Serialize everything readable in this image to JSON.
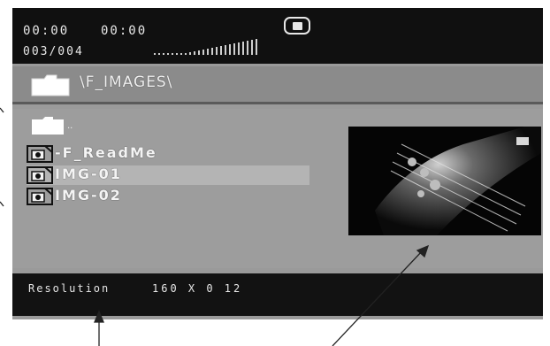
{
  "status": {
    "elapsed_time": "00:00",
    "total_time": "00:00",
    "file_counter": "003/004",
    "stop_icon": "stop-icon"
  },
  "path": {
    "text": "\\F_IMAGES\\",
    "icon": "folder-icon"
  },
  "file_list": {
    "parent_label": "..",
    "items": [
      {
        "label": "-F_ReadMe",
        "icon": "image-file-icon",
        "selected": false
      },
      {
        "label": "IMG-01",
        "icon": "image-file-icon",
        "selected": true
      },
      {
        "label": "IMG-02",
        "icon": "image-file-icon",
        "selected": false
      }
    ]
  },
  "preview": {
    "icon": "image-thumbnail"
  },
  "info": {
    "label": "Resolution",
    "value": "160 X 0 12"
  },
  "colors": {
    "bar_background": "#101010",
    "panel_background": "#9d9d9d",
    "text": "#f0f0f0",
    "selection": "#b4b4b4"
  }
}
